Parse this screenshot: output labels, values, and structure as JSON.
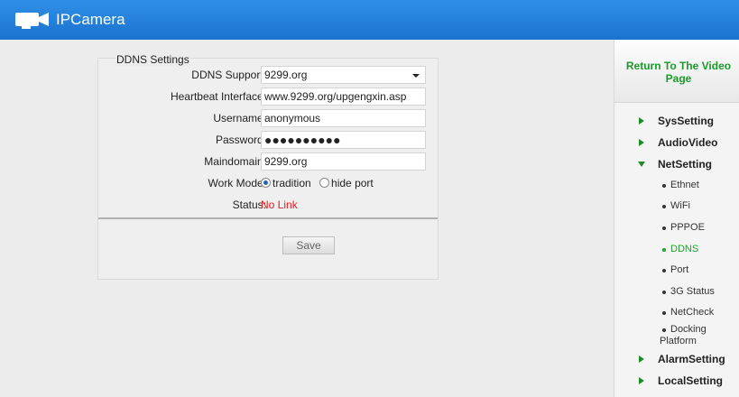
{
  "header": {
    "app_title": "IPCamera",
    "logo_icon": "camera-icon",
    "brand_color": "#1f7fdd"
  },
  "ddns": {
    "section_title": "DDNS Settings",
    "support": {
      "label": "DDNS Support:",
      "value": "9299.org"
    },
    "heartbeat": {
      "label": "Heartbeat Interface:",
      "value": "www.9299.org/upgengxin.asp"
    },
    "username": {
      "label": "Username:",
      "value": "anonymous"
    },
    "password": {
      "label": "Password:",
      "value": "●●●●●●●●●●"
    },
    "maindomain": {
      "label": "Maindomain:",
      "value": "9299.org"
    },
    "work_mode": {
      "label": "Work Mode:",
      "options": [
        "tradition",
        "hide port"
      ],
      "selected": "tradition"
    },
    "status": {
      "label": "Status:",
      "value": "No Link",
      "color": "#e02020"
    },
    "save_label": "Save"
  },
  "sidebar": {
    "return_label": "Return To The Video Page",
    "accent_color": "#1fa32c",
    "items": [
      {
        "label": "SysSetting",
        "expanded": false
      },
      {
        "label": "AudioVideo",
        "expanded": false
      },
      {
        "label": "NetSetting",
        "expanded": true
      },
      {
        "label": "AlarmSetting",
        "expanded": false
      },
      {
        "label": "LocalSetting",
        "expanded": false
      }
    ],
    "net_sub_items": [
      "Ethnet",
      "WiFi",
      "PPPOE",
      "DDNS",
      "Port",
      "3G Status",
      "NetCheck",
      "Docking",
      "Platform"
    ],
    "active_sub_item": "DDNS"
  }
}
